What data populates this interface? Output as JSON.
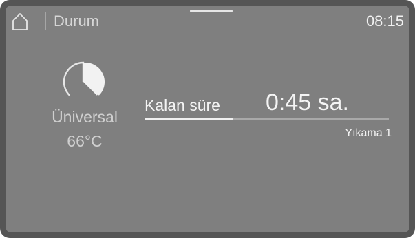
{
  "header": {
    "home_icon": "home-icon",
    "title": "Durum",
    "time": "08:15"
  },
  "program": {
    "icon": "pie-chart-icon",
    "name": "Üniversal",
    "temperature": "66°C"
  },
  "status": {
    "remaining_label": "Kalan süre",
    "remaining_value": "0:45 sa.",
    "progress_fraction": 0.36,
    "phase": "Yıkama 1"
  },
  "colors": {
    "screen_bg": "#7f7f7f",
    "bezel": "#555555",
    "text_light": "#f4f4f4",
    "text_muted": "#cfcfcf"
  }
}
